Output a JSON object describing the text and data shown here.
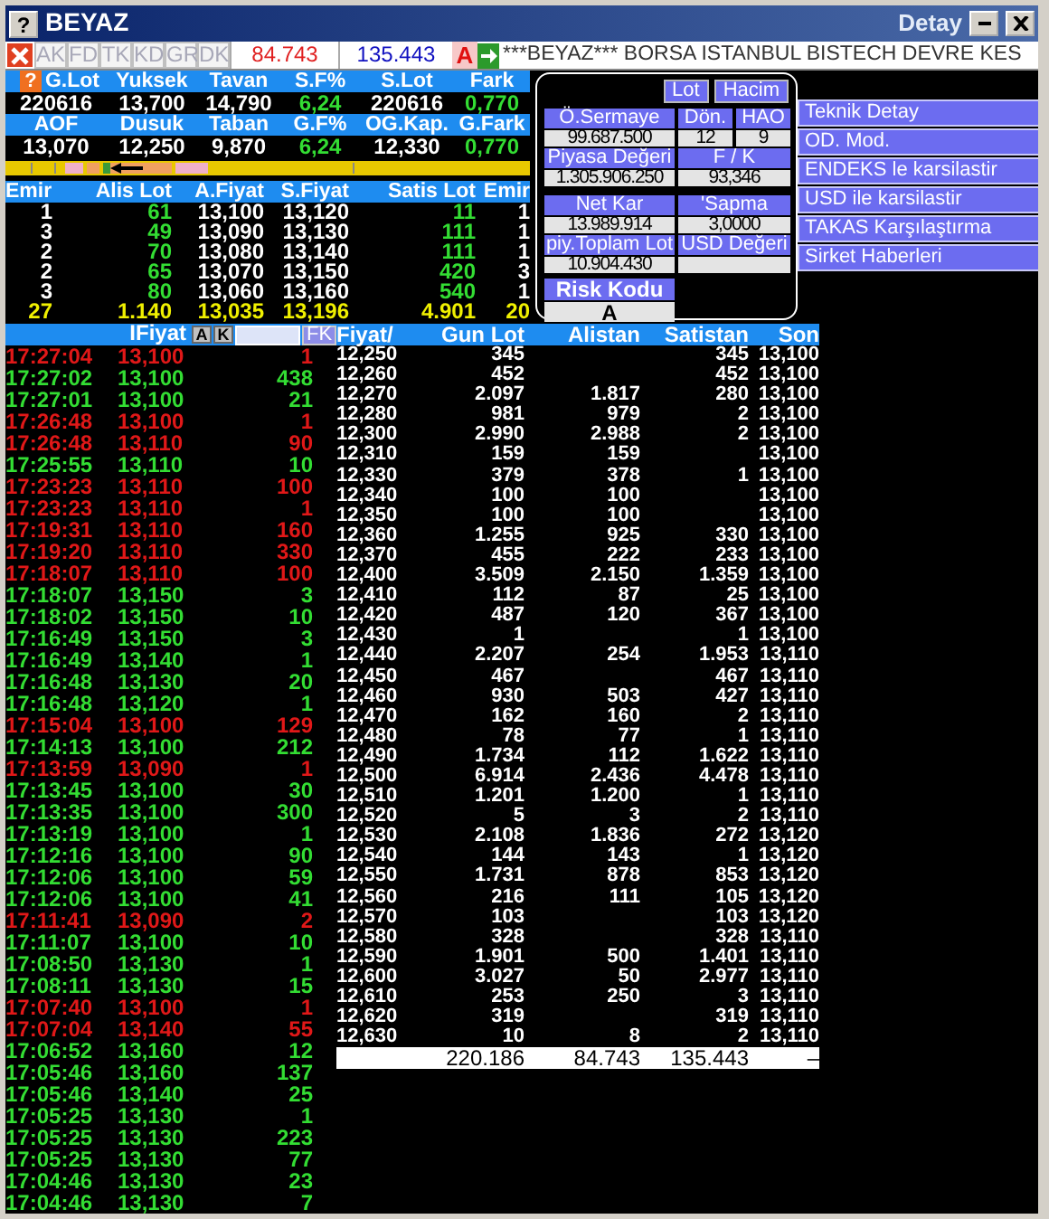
{
  "window": {
    "help": "?",
    "title": "BEYAZ",
    "subtitle": "Detay"
  },
  "toolbar": {
    "buttons": [
      {
        "label": "AK",
        "disabled": true
      },
      {
        "label": "FD",
        "disabled": true
      },
      {
        "label": "TK",
        "disabled": true
      },
      {
        "label": "KD",
        "disabled": true
      },
      {
        "label": "GR",
        "disabled": true
      },
      {
        "label": "DK",
        "disabled": true
      }
    ],
    "buy_total": "84.743",
    "sell_total": "135.443",
    "grade": "A",
    "ticker": "***BEYAZ*** BORSA ISTANBUL BISTECH DEVRE KES"
  },
  "stats": {
    "help": "?",
    "blocks": [
      {
        "headers": [
          "G.Lot",
          "Yuksek",
          "Tavan",
          "S.F%",
          "S.Lot",
          "Fark"
        ],
        "values": [
          {
            "text": "220616",
            "up": false
          },
          {
            "text": "13,700",
            "up": false
          },
          {
            "text": "14,790",
            "up": false
          },
          {
            "text": "6,24",
            "up": true
          },
          {
            "text": "220616",
            "up": false
          },
          {
            "text": "0,770",
            "up": true
          }
        ]
      },
      {
        "headers": [
          "AOF",
          "Dusuk",
          "Taban",
          "G.F%",
          "OG.Kap.",
          "G.Fark"
        ],
        "values": [
          {
            "text": "13,070",
            "up": false
          },
          {
            "text": "12,250",
            "up": false
          },
          {
            "text": "9,870",
            "up": false
          },
          {
            "text": "6,24",
            "up": true
          },
          {
            "text": "12,330",
            "up": false
          },
          {
            "text": "0,770",
            "up": true
          }
        ]
      }
    ]
  },
  "depth": {
    "columns": [
      "Emir",
      "Alis Lot",
      "A.Fiyat",
      "S.Fiyat",
      "Satis Lot",
      "Emir"
    ],
    "rows": [
      {
        "kind": "order",
        "cells": [
          "1",
          "61",
          "13,100",
          "13,120",
          "11",
          "1"
        ]
      },
      {
        "kind": "order",
        "cells": [
          "3",
          "49",
          "13,090",
          "13,130",
          "111",
          "1"
        ]
      },
      {
        "kind": "order",
        "cells": [
          "2",
          "70",
          "13,080",
          "13,140",
          "111",
          "1"
        ]
      },
      {
        "kind": "order",
        "cells": [
          "2",
          "65",
          "13,070",
          "13,150",
          "420",
          "3"
        ]
      },
      {
        "kind": "order",
        "cells": [
          "3",
          "80",
          "13,060",
          "13,160",
          "540",
          "1"
        ]
      },
      {
        "kind": "total",
        "cells": [
          "27",
          "1.140",
          "13,035",
          "13,196",
          "4.901",
          "20"
        ]
      }
    ]
  },
  "detail": {
    "toggles": [
      "Lot",
      "Hacim"
    ],
    "fields": [
      {
        "label": "Ö.Sermaye",
        "value": "99.687.500"
      },
      {
        "label": "Dön.",
        "value": "12"
      },
      {
        "label": "HAO",
        "value": "9"
      },
      {
        "label": "Piyasa Değeri",
        "value": "1.305.906.250"
      },
      {
        "label": "F / K",
        "value": "93,346"
      },
      {
        "label": "Net Kar",
        "value": "13.989.914"
      },
      {
        "label": "'Sapma",
        "value": "3,0000"
      },
      {
        "label": "piy.Toplam Lot",
        "value": "10.904.430"
      },
      {
        "label": "USD Değeri"
      },
      {
        "label": "Risk Kodu",
        "value": "A"
      }
    ]
  },
  "menu": [
    "Teknik Detay",
    "OD. Mod.",
    "ENDEKS le karsilastir",
    "USD ile karsilastir",
    "TAKAS Karşılaştırma",
    "Sirket Haberleri"
  ],
  "trades": {
    "header": "IFiyat",
    "buttons": [
      "A",
      "K"
    ],
    "filter_button": "FK",
    "rows": [
      {
        "time": "17:27:04",
        "price": "13,100",
        "lot": "1",
        "up": false
      },
      {
        "time": "17:27:02",
        "price": "13,100",
        "lot": "438",
        "up": true
      },
      {
        "time": "17:27:01",
        "price": "13,100",
        "lot": "21",
        "up": true
      },
      {
        "time": "17:26:48",
        "price": "13,100",
        "lot": "1",
        "up": false
      },
      {
        "time": "17:26:48",
        "price": "13,110",
        "lot": "90",
        "up": false
      },
      {
        "time": "17:25:55",
        "price": "13,110",
        "lot": "10",
        "up": true
      },
      {
        "time": "17:23:23",
        "price": "13,110",
        "lot": "100",
        "up": false
      },
      {
        "time": "17:23:23",
        "price": "13,110",
        "lot": "1",
        "up": false
      },
      {
        "time": "17:19:31",
        "price": "13,110",
        "lot": "160",
        "up": false
      },
      {
        "time": "17:19:20",
        "price": "13,110",
        "lot": "330",
        "up": false
      },
      {
        "time": "17:18:07",
        "price": "13,110",
        "lot": "100",
        "up": false
      },
      {
        "time": "17:18:07",
        "price": "13,150",
        "lot": "3",
        "up": true
      },
      {
        "time": "17:18:02",
        "price": "13,150",
        "lot": "10",
        "up": true
      },
      {
        "time": "17:16:49",
        "price": "13,150",
        "lot": "3",
        "up": true
      },
      {
        "time": "17:16:49",
        "price": "13,140",
        "lot": "1",
        "up": true
      },
      {
        "time": "17:16:48",
        "price": "13,130",
        "lot": "20",
        "up": true
      },
      {
        "time": "17:16:48",
        "price": "13,120",
        "lot": "1",
        "up": true
      },
      {
        "time": "17:15:04",
        "price": "13,100",
        "lot": "129",
        "up": false
      },
      {
        "time": "17:14:13",
        "price": "13,100",
        "lot": "212",
        "up": true
      },
      {
        "time": "17:13:59",
        "price": "13,090",
        "lot": "1",
        "up": false
      },
      {
        "time": "17:13:45",
        "price": "13,100",
        "lot": "30",
        "up": true
      },
      {
        "time": "17:13:35",
        "price": "13,100",
        "lot": "300",
        "up": true
      },
      {
        "time": "17:13:19",
        "price": "13,100",
        "lot": "1",
        "up": true
      },
      {
        "time": "17:12:16",
        "price": "13,100",
        "lot": "90",
        "up": true
      },
      {
        "time": "17:12:06",
        "price": "13,100",
        "lot": "59",
        "up": true
      },
      {
        "time": "17:12:06",
        "price": "13,100",
        "lot": "41",
        "up": true
      },
      {
        "time": "17:11:41",
        "price": "13,090",
        "lot": "2",
        "up": false
      },
      {
        "time": "17:11:07",
        "price": "13,100",
        "lot": "10",
        "up": true
      },
      {
        "time": "17:08:50",
        "price": "13,130",
        "lot": "1",
        "up": true
      },
      {
        "time": "17:08:11",
        "price": "13,130",
        "lot": "15",
        "up": true
      },
      {
        "time": "17:07:40",
        "price": "13,100",
        "lot": "1",
        "up": false
      },
      {
        "time": "17:07:04",
        "price": "13,140",
        "lot": "55",
        "up": false
      },
      {
        "time": "17:06:52",
        "price": "13,160",
        "lot": "12",
        "up": true
      },
      {
        "time": "17:05:46",
        "price": "13,160",
        "lot": "137",
        "up": true
      },
      {
        "time": "17:05:46",
        "price": "13,140",
        "lot": "25",
        "up": true
      },
      {
        "time": "17:05:25",
        "price": "13,130",
        "lot": "1",
        "up": true
      },
      {
        "time": "17:05:25",
        "price": "13,130",
        "lot": "223",
        "up": true
      },
      {
        "time": "17:05:25",
        "price": "13,130",
        "lot": "77",
        "up": true
      },
      {
        "time": "17:04:46",
        "price": "13,130",
        "lot": "23",
        "up": true
      },
      {
        "time": "17:04:46",
        "price": "13,130",
        "lot": "7",
        "up": true
      }
    ]
  },
  "price_table": {
    "columns": [
      "Fiyat/",
      "Gun Lot",
      "Alistan",
      "Satistan",
      "Son"
    ],
    "rows": [
      {
        "fiyat": "12,250",
        "gun_lot": "345",
        "satistan": "345",
        "son": "13,100"
      },
      {
        "fiyat": "12,260",
        "gun_lot": "452",
        "satistan": "452",
        "son": "13,100"
      },
      {
        "fiyat": "12,270",
        "gun_lot": "2.097",
        "alistan": "1.817",
        "satistan": "280",
        "son": "13,100"
      },
      {
        "fiyat": "12,280",
        "gun_lot": "981",
        "alistan": "979",
        "satistan": "2",
        "son": "13,100"
      },
      {
        "fiyat": "12,300",
        "gun_lot": "2.990",
        "alistan": "2.988",
        "satistan": "2",
        "son": "13,100"
      },
      {
        "fiyat": "12,310",
        "gun_lot": "159",
        "alistan": "159",
        "son": "13,100"
      },
      {
        "fiyat": "12,330",
        "gun_lot": "379",
        "alistan": "378",
        "satistan": "1",
        "son": "13,100"
      },
      {
        "fiyat": "12,340",
        "gun_lot": "100",
        "alistan": "100",
        "son": "13,100"
      },
      {
        "fiyat": "12,350",
        "gun_lot": "100",
        "alistan": "100",
        "son": "13,100"
      },
      {
        "fiyat": "12,360",
        "gun_lot": "1.255",
        "alistan": "925",
        "satistan": "330",
        "son": "13,100"
      },
      {
        "fiyat": "12,370",
        "gun_lot": "455",
        "alistan": "222",
        "satistan": "233",
        "son": "13,100"
      },
      {
        "fiyat": "12,400",
        "gun_lot": "3.509",
        "alistan": "2.150",
        "satistan": "1.359",
        "son": "13,100"
      },
      {
        "fiyat": "12,410",
        "gun_lot": "112",
        "alistan": "87",
        "satistan": "25",
        "son": "13,100"
      },
      {
        "fiyat": "12,420",
        "gun_lot": "487",
        "alistan": "120",
        "satistan": "367",
        "son": "13,100"
      },
      {
        "fiyat": "12,430",
        "gun_lot": "1",
        "satistan": "1",
        "son": "13,100"
      },
      {
        "fiyat": "12,440",
        "gun_lot": "2.207",
        "alistan": "254",
        "satistan": "1.953",
        "son": "13,110"
      },
      {
        "fiyat": "12,450",
        "gun_lot": "467",
        "satistan": "467",
        "son": "13,110"
      },
      {
        "fiyat": "12,460",
        "gun_lot": "930",
        "alistan": "503",
        "satistan": "427",
        "son": "13,110"
      },
      {
        "fiyat": "12,470",
        "gun_lot": "162",
        "alistan": "160",
        "satistan": "2",
        "son": "13,110"
      },
      {
        "fiyat": "12,480",
        "gun_lot": "78",
        "alistan": "77",
        "satistan": "1",
        "son": "13,110"
      },
      {
        "fiyat": "12,490",
        "gun_lot": "1.734",
        "alistan": "112",
        "satistan": "1.622",
        "son": "13,110"
      },
      {
        "fiyat": "12,500",
        "gun_lot": "6.914",
        "alistan": "2.436",
        "satistan": "4.478",
        "son": "13,110"
      },
      {
        "fiyat": "12,510",
        "gun_lot": "1.201",
        "alistan": "1.200",
        "satistan": "1",
        "son": "13,110"
      },
      {
        "fiyat": "12,520",
        "gun_lot": "5",
        "alistan": "3",
        "satistan": "2",
        "son": "13,110"
      },
      {
        "fiyat": "12,530",
        "gun_lot": "2.108",
        "alistan": "1.836",
        "satistan": "272",
        "son": "13,120"
      },
      {
        "fiyat": "12,540",
        "gun_lot": "144",
        "alistan": "143",
        "satistan": "1",
        "son": "13,120"
      },
      {
        "fiyat": "12,550",
        "gun_lot": "1.731",
        "alistan": "878",
        "satistan": "853",
        "son": "13,120"
      },
      {
        "fiyat": "12,560",
        "gun_lot": "216",
        "alistan": "111",
        "satistan": "105",
        "son": "13,120"
      },
      {
        "fiyat": "12,570",
        "gun_lot": "103",
        "satistan": "103",
        "son": "13,120"
      },
      {
        "fiyat": "12,580",
        "gun_lot": "328",
        "satistan": "328",
        "son": "13,110"
      },
      {
        "fiyat": "12,590",
        "gun_lot": "1.901",
        "alistan": "500",
        "satistan": "1.401",
        "son": "13,110"
      },
      {
        "fiyat": "12,600",
        "gun_lot": "3.027",
        "alistan": "50",
        "satistan": "2.977",
        "son": "13,110"
      },
      {
        "fiyat": "12,610",
        "gun_lot": "253",
        "alistan": "250",
        "satistan": "3",
        "son": "13,110"
      },
      {
        "fiyat": "12,620",
        "gun_lot": "319",
        "satistan": "319",
        "son": "13,110"
      },
      {
        "fiyat": "12,630",
        "gun_lot": "10",
        "alistan": "8",
        "satistan": "2",
        "son": "13,110"
      }
    ],
    "totals": {
      "gun_lot": "220.186",
      "alistan": "84.743",
      "satistan": "135.443",
      "son": "–"
    }
  }
}
